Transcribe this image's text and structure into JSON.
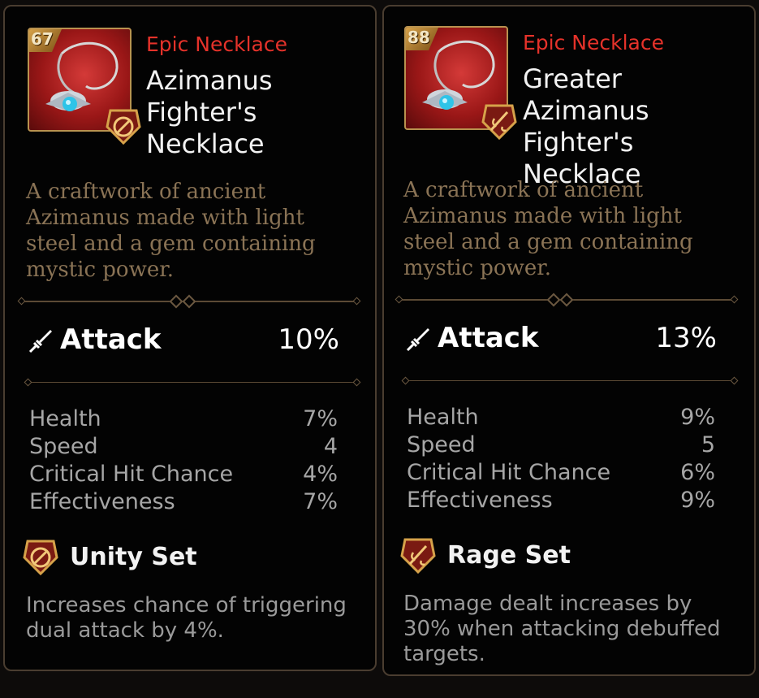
{
  "cards": [
    {
      "level": "67",
      "rarity": "Epic Necklace",
      "name_lines": [
        "Azimanus",
        "Fighter's",
        "Necklace"
      ],
      "description": [
        "A craftwork of ancient",
        "Azimanus made with light",
        "steel and a gem containing",
        "mystic power."
      ],
      "main_stat": {
        "label": "Attack",
        "value": "10%",
        "icon": "sword-icon"
      },
      "sub_stats": [
        {
          "label": "Health",
          "value": "7%"
        },
        {
          "label": "Speed",
          "value": "4"
        },
        {
          "label": "Critical Hit Chance",
          "value": "4%"
        },
        {
          "label": "Effectiveness",
          "value": "7%"
        }
      ],
      "set": {
        "name": "Unity Set",
        "icon": "unity-set-icon",
        "effect": [
          "Increases chance of triggering",
          "dual attack by 4%."
        ]
      }
    },
    {
      "level": "88",
      "rarity": "Epic Necklace",
      "name_lines": [
        "Greater",
        "Azimanus",
        "Fighter's",
        "Necklace"
      ],
      "description": [
        "A craftwork of ancient",
        "Azimanus made with light",
        "steel and a gem containing",
        "mystic power."
      ],
      "main_stat": {
        "label": "Attack",
        "value": "13%",
        "icon": "sword-icon"
      },
      "sub_stats": [
        {
          "label": "Health",
          "value": "9%"
        },
        {
          "label": "Speed",
          "value": "5"
        },
        {
          "label": "Critical Hit Chance",
          "value": "6%"
        },
        {
          "label": "Effectiveness",
          "value": "9%"
        }
      ],
      "set": {
        "name": "Rage Set",
        "icon": "rage-set-icon",
        "effect": [
          "Damage dealt increases by",
          "30% when attacking debuffed",
          "targets."
        ]
      }
    }
  ],
  "colors": {
    "rarity": "#e5322a",
    "frame": "#4a3d30",
    "description": "#8a7355",
    "gold": "#b8924f"
  }
}
